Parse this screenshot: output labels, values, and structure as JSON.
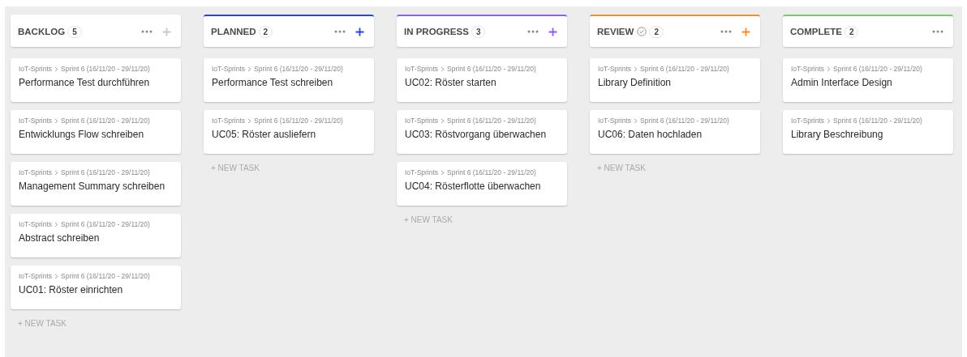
{
  "columns": [
    {
      "title": "BACKLOG",
      "count": "5",
      "check_icon": false,
      "add_button": true,
      "new_task": "+ NEW TASK",
      "tasks": [
        {
          "path": "IoT-Sprints",
          "sprint": "Sprint 6 (16/11/20 - 29/11/20)",
          "title": "Performance Test durchführen"
        },
        {
          "path": "IoT-Sprints",
          "sprint": "Sprint 6 (16/11/20 - 29/11/20)",
          "title": "Entwicklungs Flow schreiben"
        },
        {
          "path": "IoT-Sprints",
          "sprint": "Sprint 6 (16/11/20 - 29/11/20)",
          "title": "Management Summary schreiben"
        },
        {
          "path": "IoT-Sprints",
          "sprint": "Sprint 6 (16/11/20 - 29/11/20)",
          "title": "Abstract schreiben"
        },
        {
          "path": "IoT-Sprints",
          "sprint": "Sprint 6 (16/11/20 - 29/11/20)",
          "title": "UC01: Röster einrichten"
        }
      ]
    },
    {
      "title": "PLANNED",
      "count": "2",
      "color": "#2845d6",
      "check_icon": false,
      "add_button": true,
      "new_task": "+ NEW TASK",
      "tasks": [
        {
          "path": "IoT-Sprints",
          "sprint": "Sprint 6 (16/11/20 - 29/11/20)",
          "title": "Performance Test schreiben"
        },
        {
          "path": "IoT-Sprints",
          "sprint": "Sprint 6 (16/11/20 - 29/11/20)",
          "title": "UC05: Röster ausliefern"
        }
      ]
    },
    {
      "title": "IN PROGRESS",
      "count": "3",
      "color": "#8e5cf7",
      "check_icon": false,
      "add_button": true,
      "new_task": "+ NEW TASK",
      "tasks": [
        {
          "path": "IoT-Sprints",
          "sprint": "Sprint 6 (16/11/20 - 29/11/20)",
          "title": "UC02: Röster starten"
        },
        {
          "path": "IoT-Sprints",
          "sprint": "Sprint 6 (16/11/20 - 29/11/20)",
          "title": "UC03: Röstvorgang überwachen"
        },
        {
          "path": "IoT-Sprints",
          "sprint": "Sprint 6 (16/11/20 - 29/11/20)",
          "title": "UC04: Rösterflotte überwachen"
        }
      ]
    },
    {
      "title": "REVIEW",
      "count": "2",
      "color": "#ff8a1f",
      "check_icon": true,
      "add_button": true,
      "new_task": "+ NEW TASK",
      "tasks": [
        {
          "path": "IoT-Sprints",
          "sprint": "Sprint 6 (16/11/20 - 29/11/20)",
          "title": "Library Definition"
        },
        {
          "path": "IoT-Sprints",
          "sprint": "Sprint 6 (16/11/20 - 29/11/20)",
          "title": "UC06: Daten hochladen"
        }
      ]
    },
    {
      "title": "COMPLETE",
      "count": "2",
      "color": "#6bd35e",
      "check_icon": false,
      "add_button": false,
      "tasks": [
        {
          "path": "IoT-Sprints",
          "sprint": "Sprint 6 (16/11/20 - 29/11/20)",
          "title": "Admin Interface Design"
        },
        {
          "path": "IoT-Sprints",
          "sprint": "Sprint 6 (16/11/20 - 29/11/20)",
          "title": "Library Beschreibung"
        }
      ]
    }
  ]
}
